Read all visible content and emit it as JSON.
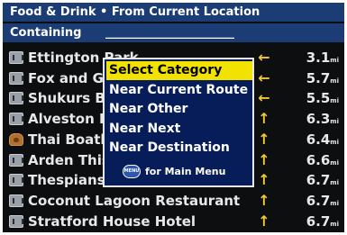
{
  "header": {
    "title": "Food & Drink • From Current Location",
    "search_label": "Containing",
    "search_value": "______________________"
  },
  "results": [
    {
      "name": "Ettington Park",
      "icon": "restaurant-icon",
      "arrow": "←",
      "distance": "3.1"
    },
    {
      "name": "Fox and Goose",
      "icon": "restaurant-icon",
      "arrow": "←",
      "distance": "5.7"
    },
    {
      "name": "Shukurs Balti",
      "icon": "restaurant-icon",
      "arrow": "←",
      "distance": "5.5"
    },
    {
      "name": "Alveston Manor",
      "icon": "restaurant-icon",
      "arrow": "↑",
      "distance": "6.3"
    },
    {
      "name": "Thai Boathouse",
      "icon": "coffee-icon",
      "arrow": "↑",
      "distance": "6.4"
    },
    {
      "name": "Arden Thistle",
      "icon": "restaurant-icon",
      "arrow": "↑",
      "distance": "6.6"
    },
    {
      "name": "Thespians",
      "icon": "restaurant-icon",
      "arrow": "↑",
      "distance": "6.7"
    },
    {
      "name": "Coconut Lagoon Restaurant",
      "icon": "restaurant-icon",
      "arrow": "↑",
      "distance": "6.7"
    },
    {
      "name": "Stratford House Hotel",
      "icon": "restaurant-icon",
      "arrow": "↑",
      "distance": "6.7"
    }
  ],
  "distance_unit": "mi",
  "popup": {
    "items": [
      {
        "label": "Select Category",
        "selected": true
      },
      {
        "label": "Near Current Route",
        "selected": false
      },
      {
        "label": "Near Other",
        "selected": false
      },
      {
        "label": "Near Next",
        "selected": false
      },
      {
        "label": "Near Destination",
        "selected": false
      }
    ],
    "menu_key_label": "MENU",
    "hint": "for Main Menu"
  },
  "colors": {
    "bar": "#1b3c74",
    "popup_bg": "#071d5a",
    "highlight": "#f2e200",
    "arrow": "#f0c830"
  }
}
